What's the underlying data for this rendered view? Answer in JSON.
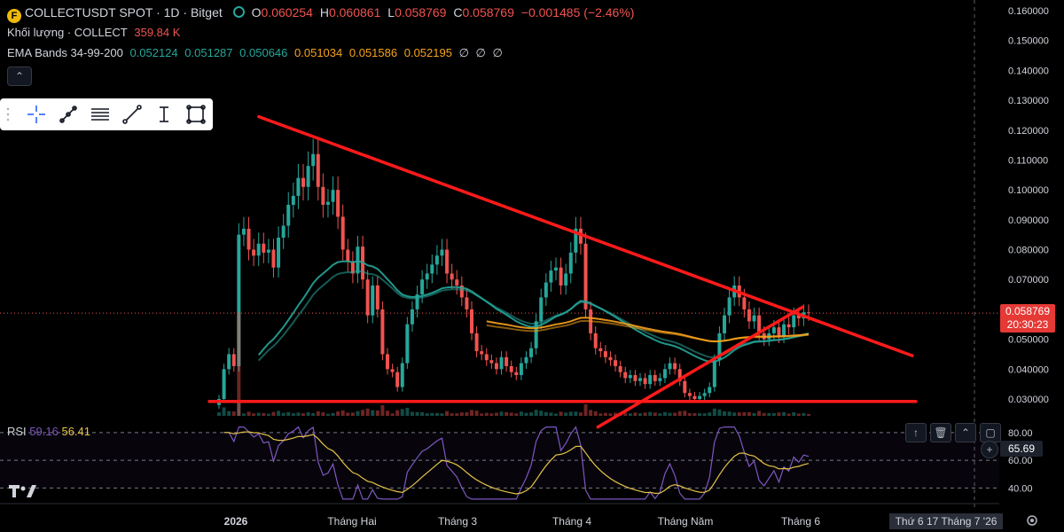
{
  "header": {
    "symbol_icon": "F",
    "symbol": "COLLECTUSDT SPOT · 1D · Bitget",
    "ohlc": {
      "o_label": "O",
      "o": "0.060254",
      "h_label": "H",
      "h": "0.060861",
      "l_label": "L",
      "l": "0.058769",
      "c_label": "C",
      "c": "0.058769",
      "change": "−0.001485 (−2.46%)"
    },
    "volume": {
      "label": "Khối lượng · COLLECT",
      "value": "359.84 K"
    },
    "ema": {
      "label": "EMA Bands 34-99-200",
      "teal_values": [
        "0.052124",
        "0.051287",
        "0.050646"
      ],
      "orange_values": [
        "0.051034",
        "0.051586",
        "0.052195"
      ],
      "empty_values": [
        "∅",
        "∅",
        "∅"
      ]
    }
  },
  "price_tag": {
    "price": "0.058769",
    "countdown": "20:30:23"
  },
  "rsi": {
    "label": "RSI",
    "value1": "59.16",
    "value2": "56.41",
    "current": "65.69",
    "ticks": [
      "80.00",
      "60.00",
      "40.00"
    ]
  },
  "time_axis": {
    "labels": [
      "2026",
      "Tháng Hai",
      "Tháng 3",
      "Tháng 4",
      "Tháng Năm",
      "Tháng 6"
    ],
    "cursor_date": "Thứ 6 17 Tháng 7 '26"
  },
  "colors": {
    "up": "#26a69a",
    "down": "#ef5350",
    "trendline": "#ff1a1a",
    "ema_teal": "#26a69a",
    "ema_orange": "#f7a21b",
    "rsi_line": "#7e57c2",
    "rsi_ma": "#e6c34a"
  },
  "icons": {
    "toolbar": [
      "crosshair-icon",
      "trend-line-icon",
      "horizontal-lines-icon",
      "line-icon",
      "text-cursor-icon",
      "rectangle-icon"
    ],
    "rsi_controls": [
      "arrow-up-icon",
      "trash-icon",
      "chevrons-up-icon",
      "maximize-icon",
      "add-icon"
    ],
    "misc": [
      "collapse-icon",
      "tradingview-logo-icon",
      "settings-icon"
    ]
  },
  "chart_data": {
    "type": "candlestick",
    "title": "COLLECTUSDT SPOT · 1D · Bitget",
    "y_ticks": [
      "0.160000",
      "0.150000",
      "0.140000",
      "0.130000",
      "0.120000",
      "0.110000",
      "0.100000",
      "0.090000",
      "0.080000",
      "0.070000",
      "0.060000",
      "0.050000",
      "0.040000",
      "0.030000"
    ],
    "ylim": [
      0.027,
      0.162
    ],
    "x_labels": [
      "2026",
      "Tháng Hai",
      "Tháng 3",
      "Tháng 4",
      "Tháng Năm",
      "Tháng 6"
    ],
    "grid": false,
    "last_price": 0.058769,
    "series_close": [
      0.03,
      0.04,
      0.045,
      0.041,
      0.085,
      0.087,
      0.08,
      0.078,
      0.082,
      0.079,
      0.08,
      0.074,
      0.084,
      0.088,
      0.095,
      0.098,
      0.104,
      0.101,
      0.108,
      0.112,
      0.101,
      0.095,
      0.096,
      0.1,
      0.091,
      0.08,
      0.076,
      0.072,
      0.081,
      0.07,
      0.058,
      0.068,
      0.06,
      0.045,
      0.04,
      0.039,
      0.034,
      0.042,
      0.055,
      0.06,
      0.065,
      0.07,
      0.072,
      0.075,
      0.078,
      0.08,
      0.072,
      0.07,
      0.068,
      0.064,
      0.06,
      0.052,
      0.046,
      0.045,
      0.043,
      0.042,
      0.04,
      0.044,
      0.041,
      0.039,
      0.038,
      0.042,
      0.044,
      0.047,
      0.056,
      0.064,
      0.069,
      0.073,
      0.074,
      0.068,
      0.072,
      0.079,
      0.087,
      0.082,
      0.06,
      0.052,
      0.047,
      0.046,
      0.044,
      0.043,
      0.041,
      0.039,
      0.037,
      0.038,
      0.036,
      0.037,
      0.035,
      0.038,
      0.036,
      0.037,
      0.04,
      0.042,
      0.04,
      0.036,
      0.032,
      0.031,
      0.03,
      0.031,
      0.032,
      0.034,
      0.043,
      0.052,
      0.058,
      0.064,
      0.068,
      0.064,
      0.06,
      0.056,
      0.058,
      0.052,
      0.05,
      0.052,
      0.054,
      0.051,
      0.055,
      0.054,
      0.058,
      0.057,
      0.059,
      0.0588
    ],
    "trendlines": [
      {
        "name": "descending-resistance",
        "from": [
          "2026-01-09",
          0.1245
        ],
        "to": [
          "2026-07-13",
          0.0445
        ]
      },
      {
        "name": "horizontal-support",
        "from": [
          "2025-12-26",
          0.0292
        ],
        "to": [
          "2026-07-14",
          0.0292
        ]
      },
      {
        "name": "ascending-support",
        "from": [
          "2026-04-15",
          0.0206
        ],
        "to": [
          "2026-06-12",
          0.0608
        ]
      }
    ],
    "rsi": {
      "ylim": [
        30,
        85
      ],
      "levels": [
        80,
        60,
        40
      ]
    }
  }
}
